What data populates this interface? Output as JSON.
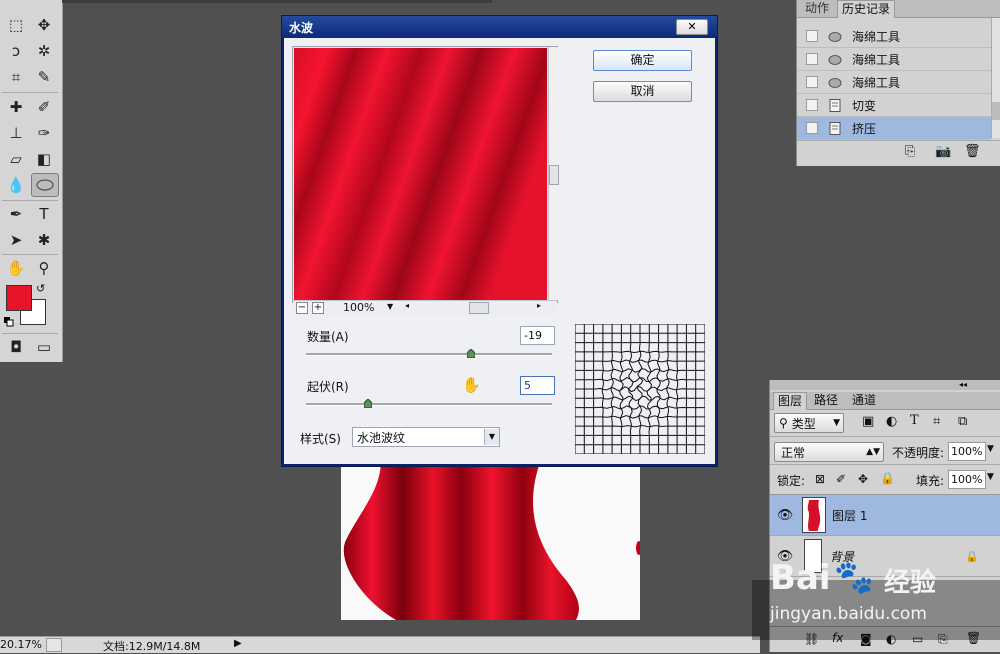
{
  "dialog": {
    "title": "水波",
    "close_label": "✕",
    "ok_label": "确定",
    "cancel_label": "取消",
    "zoom": "100%",
    "amount_label": "数量(A)",
    "amount_value": "-19",
    "amount_level": 0.67,
    "ridges_label": "起伏(R)",
    "ridges_value": "5",
    "ridges_level": 0.25,
    "style_label": "样式(S)",
    "style_value": "水池波纹"
  },
  "history": {
    "tabs": [
      "动作",
      "历史记录"
    ],
    "items": [
      "海绵工具",
      "海绵工具",
      "海绵工具",
      "切变",
      "挤压"
    ]
  },
  "layers": {
    "tabs": [
      "图层",
      "路径",
      "通道"
    ],
    "filter_label": "类型",
    "blend_mode": "正常",
    "opacity_label": "不透明度:",
    "opacity_value": "100%",
    "lock_label": "锁定:",
    "fill_label": "填充:",
    "fill_value": "100%",
    "rows": [
      "图层 1",
      "背景"
    ]
  },
  "status": {
    "zoom": "20.17%",
    "doc_info": "文档:12.9M/14.8M"
  },
  "watermark": {
    "brand": "Bai",
    "brand_suffix": "经验",
    "url": "jingyan.baidu.com"
  },
  "colors": {
    "foreground": "#e8142a",
    "background": "#ffffff",
    "selection": "#9fb8e0",
    "dialog_title": "#0a246a"
  }
}
